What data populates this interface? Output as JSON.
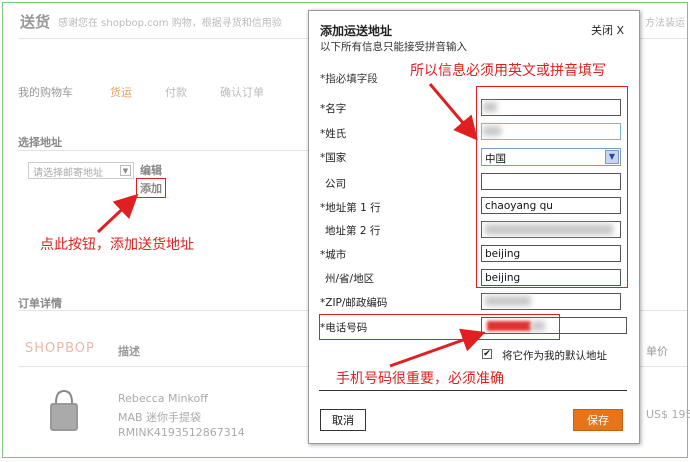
{
  "background": {
    "title": "送货",
    "subtitle": "感谢您在 shopbop.com 购物，根据寻货和信用验",
    "subtitle_right": "方法装运",
    "steps": {
      "cart": "我的购物车",
      "shipping": "货运",
      "payment": "付款",
      "confirm": "确认订单"
    },
    "select_address_title": "选择地址",
    "address_select_placeholder": "请选择邮寄地址",
    "edit_label": "编辑",
    "add_button_label": "添加",
    "order_details_title": "订单详情",
    "brand_logo": "SHOPBOP",
    "desc_header": "描述",
    "price_header": "单价",
    "product": {
      "brand": "Rebecca Minkoff",
      "name": "MAB 迷你手提袋",
      "sku": "RMINK4193512867314",
      "price": "US$ 195"
    }
  },
  "dialog": {
    "title": "添加运送地址",
    "close_label": "关闭 X",
    "note": "以下所有信息只能接受拼音输入",
    "required_note": "*指必填字段",
    "fields": {
      "first_name": {
        "label": "*名字",
        "value": ""
      },
      "last_name": {
        "label": "*姓氏",
        "value": ""
      },
      "country": {
        "label": "*国家",
        "value": "中国"
      },
      "company": {
        "label": "公司",
        "value": ""
      },
      "address1": {
        "label": "*地址第 1 行",
        "value": "chaoyang qu"
      },
      "address2": {
        "label": "地址第 2 行",
        "value": ""
      },
      "city": {
        "label": "*城市",
        "value": "beijing"
      },
      "province": {
        "label": "州/省/地区",
        "value": "beijing"
      },
      "zip": {
        "label": "*ZIP/邮政编码",
        "value": ""
      },
      "phone": {
        "label": "*电话号码",
        "value": ""
      }
    },
    "default_address_label": "将它作为我的默认地址",
    "default_checked": "✔",
    "cancel_label": "取消",
    "save_label": "保存"
  },
  "annotations": {
    "pinyin_note": "所以信息必须用英文或拼音填写",
    "click_add_note": "点此按钮，添加送货地址",
    "phone_note": "手机号码很重要，必须准确"
  },
  "colors": {
    "annotation_red": "#e02020",
    "save_orange": "#e8741a",
    "frame_green": "#7cc47a"
  }
}
